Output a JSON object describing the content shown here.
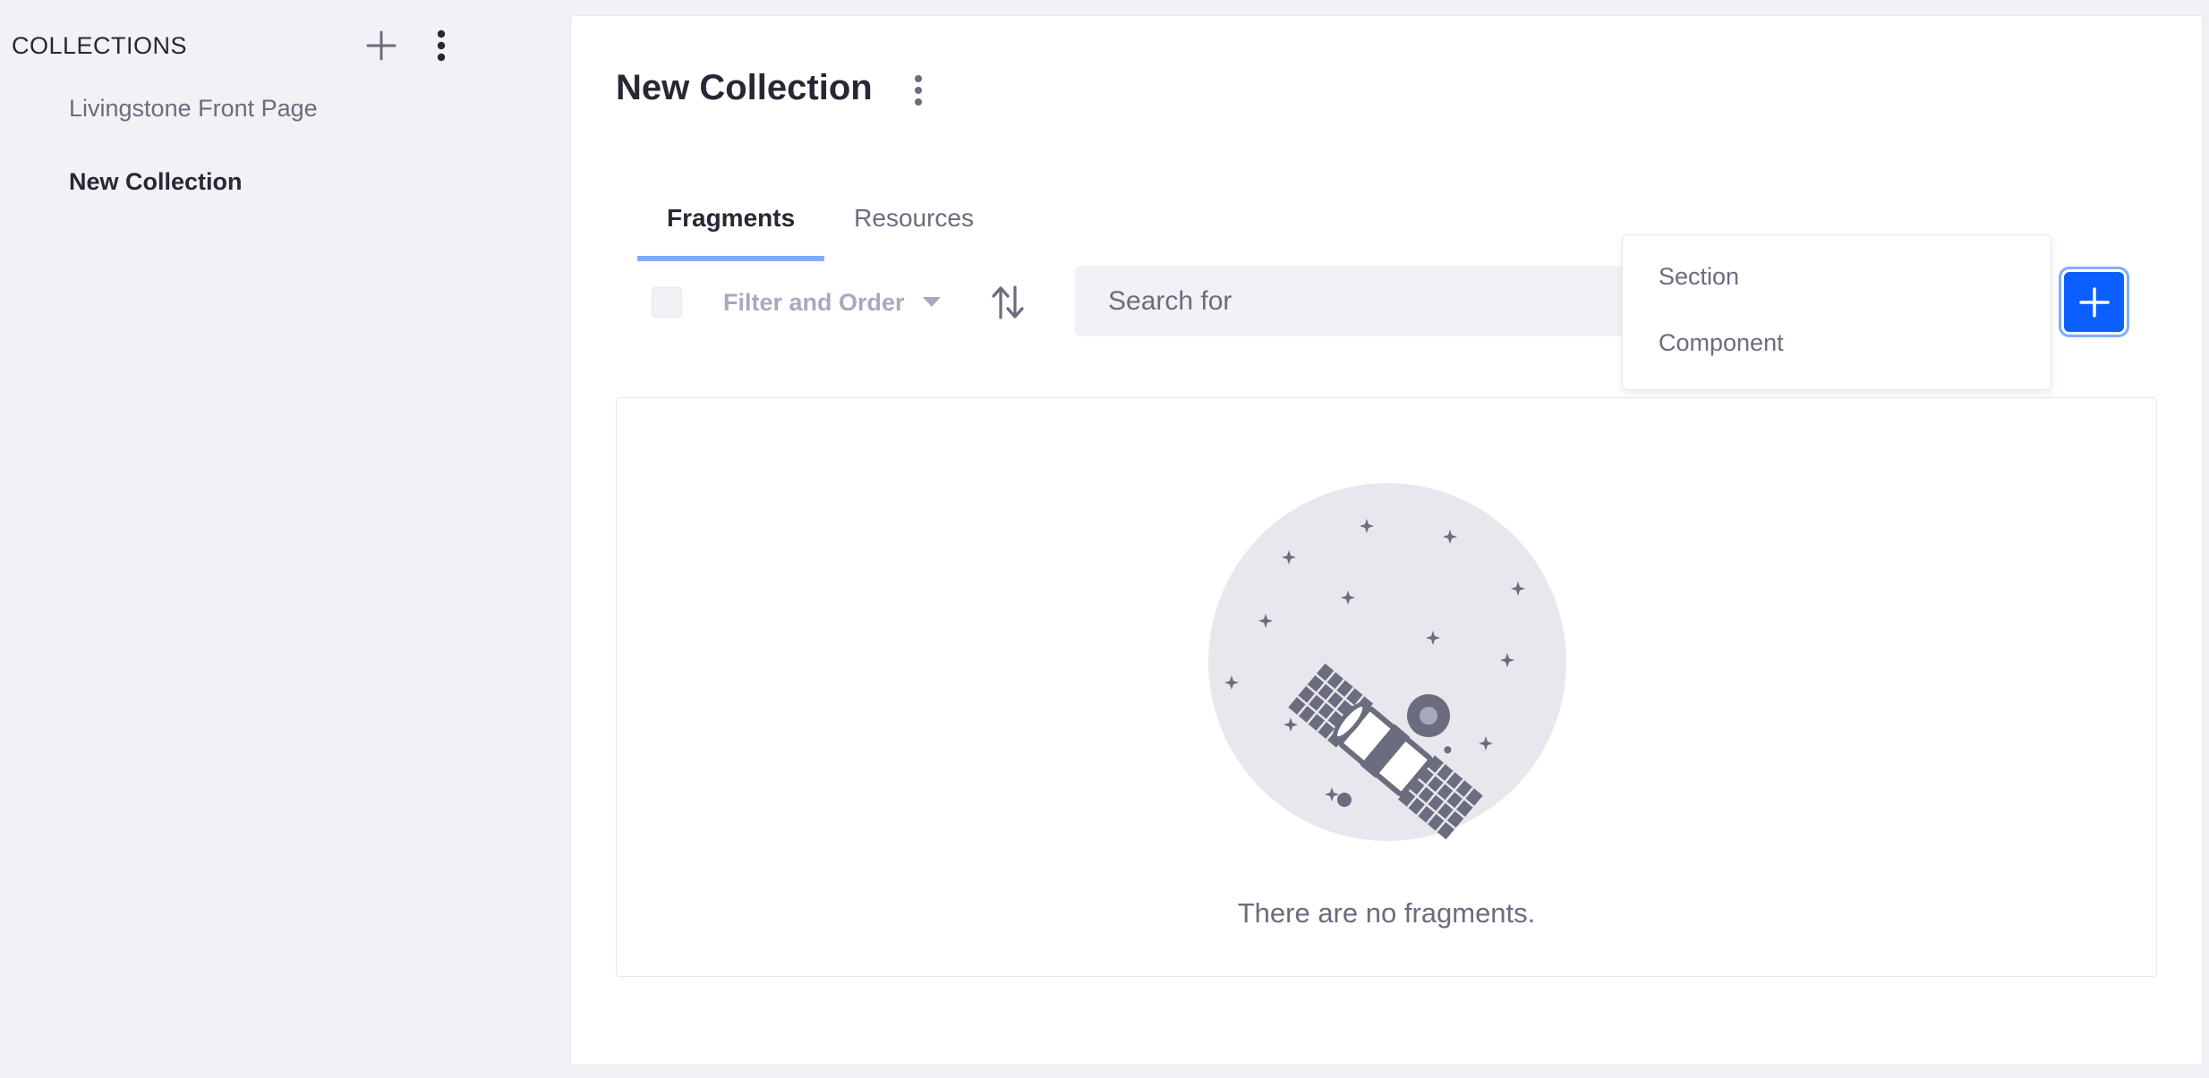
{
  "sidebar": {
    "title": "COLLECTIONS",
    "items": [
      {
        "label": "Livingstone Front Page"
      },
      {
        "label": "New Collection"
      }
    ]
  },
  "main": {
    "title": "New Collection",
    "tabs": [
      {
        "label": "Fragments",
        "active": true
      },
      {
        "label": "Resources",
        "active": false
      }
    ],
    "toolbar": {
      "filter_label": "Filter and Order",
      "search_placeholder": "Search for"
    },
    "add_menu": {
      "items": [
        {
          "label": "Section"
        },
        {
          "label": "Component"
        }
      ]
    },
    "empty_state": {
      "message": "There are no fragments."
    }
  },
  "colors": {
    "accent": "#0b5fff",
    "tab_underline": "#80acff",
    "background": "#f1f2f5"
  },
  "icons": [
    "plus-icon",
    "vertical-ellipsis-icon",
    "caret-down-icon",
    "sort-arrows-icon",
    "satellite-illustration"
  ]
}
